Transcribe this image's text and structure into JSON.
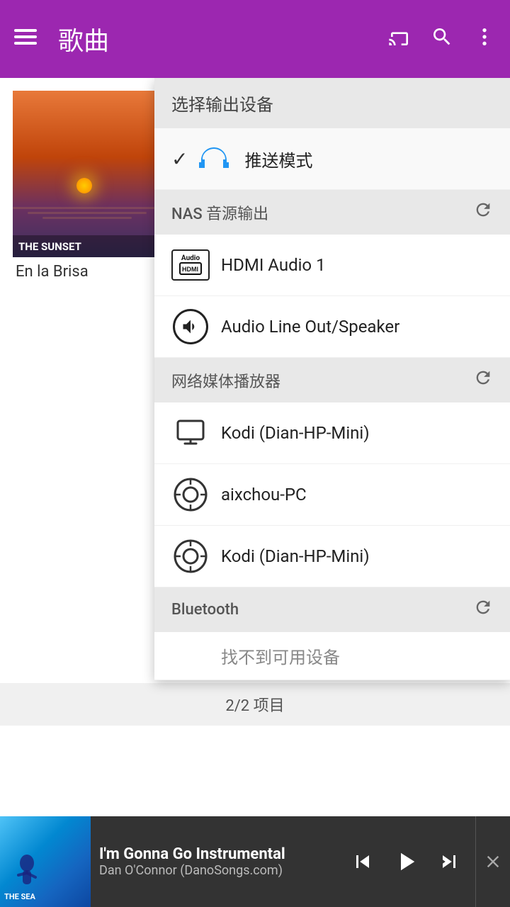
{
  "header": {
    "menu_label": "☰",
    "title": "歌曲",
    "cast_icon": "cast",
    "search_icon": "search",
    "more_icon": "more"
  },
  "song_card": {
    "thumbnail_label": "THE SUNSET",
    "name": "En la Brisa"
  },
  "dropdown": {
    "header": "选择输出设备",
    "selected_icon": "✓",
    "push_mode_label": "推送模式",
    "nas_section": "NAS 音源输出",
    "hdmi_label": "HDMI Audio 1",
    "speaker_label": "Audio Line Out/Speaker",
    "network_section": "网络媒体播放器",
    "kodi1_label": "Kodi (Dian-HP-Mini)",
    "aixchou_label": "aixchou-PC",
    "kodi2_label": "Kodi (Dian-HP-Mini)",
    "bluetooth_section": "Bluetooth",
    "no_device_label": "找不到可用设备"
  },
  "status_bar": {
    "items_count": "2/2 项目"
  },
  "now_playing": {
    "thumb_label": "THE SEA",
    "title": "I'm Gonna Go Instrumental",
    "artist": "Dan O'Connor (DanoSongs.com)"
  }
}
